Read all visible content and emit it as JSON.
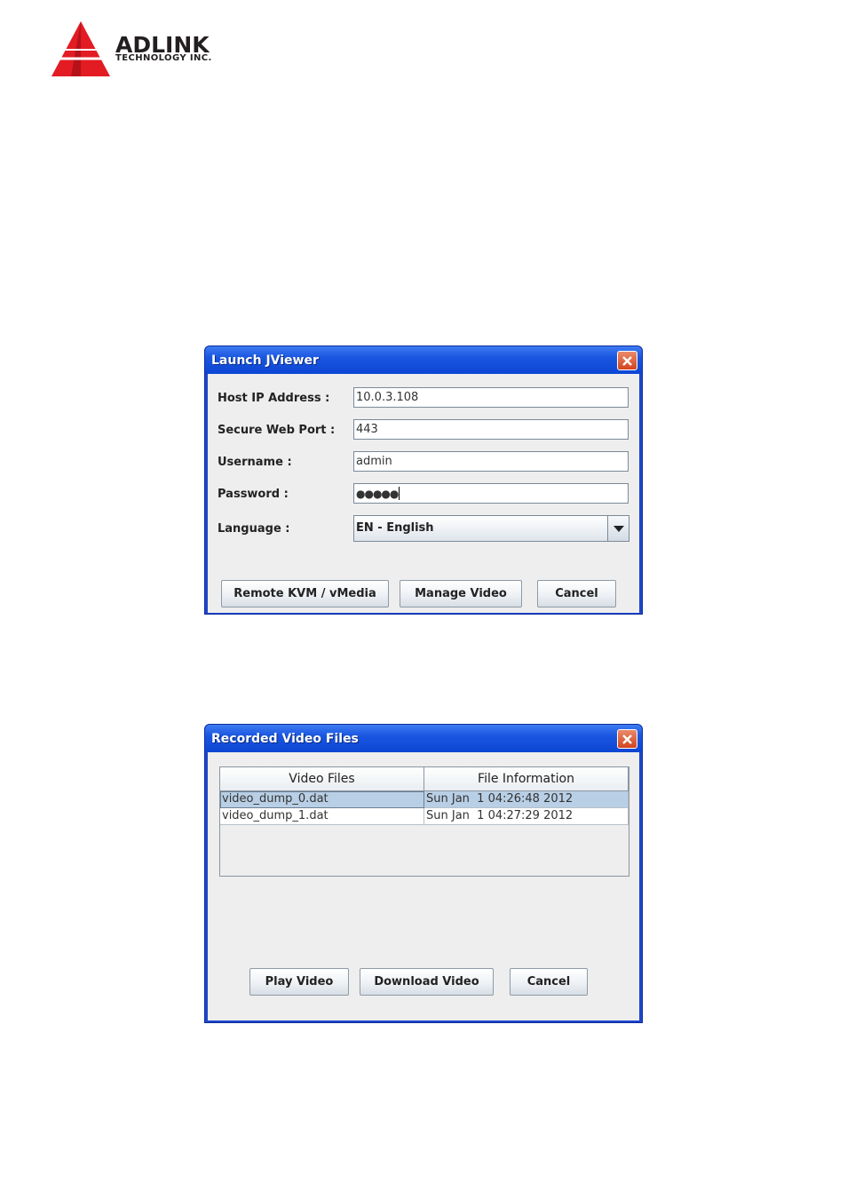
{
  "logo": {
    "name": "ADLINK",
    "subtitle": "TECHNOLOGY INC."
  },
  "launch": {
    "title": "Launch JViewer",
    "host_label": "Host IP Address :",
    "host_value": "10.0.3.108",
    "port_label": "Secure Web Port :",
    "port_value": "443",
    "user_label": "Username :",
    "user_value": "admin",
    "password_label": "Password :",
    "password_value": "●●●●●",
    "language_label": "Language :",
    "language_value": "EN - English",
    "btn_remote": "Remote KVM / vMedia",
    "btn_manage": "Manage Video",
    "btn_cancel": "Cancel"
  },
  "recorded": {
    "title": "Recorded Video Files",
    "columns": [
      "Video Files",
      "File Information"
    ],
    "rows": [
      {
        "file": "video_dump_0.dat",
        "info": "Sun Jan  1 04:26:48 2012",
        "selected": true
      },
      {
        "file": "video_dump_1.dat",
        "info": "Sun Jan  1 04:27:29 2012",
        "selected": false
      }
    ],
    "btn_play": "Play Video",
    "btn_download": "Download Video",
    "btn_cancel": "Cancel"
  },
  "colors": {
    "logo_red": "#e31b23",
    "title_blue": "#0c46d4",
    "selection": "#b8cfe5"
  }
}
